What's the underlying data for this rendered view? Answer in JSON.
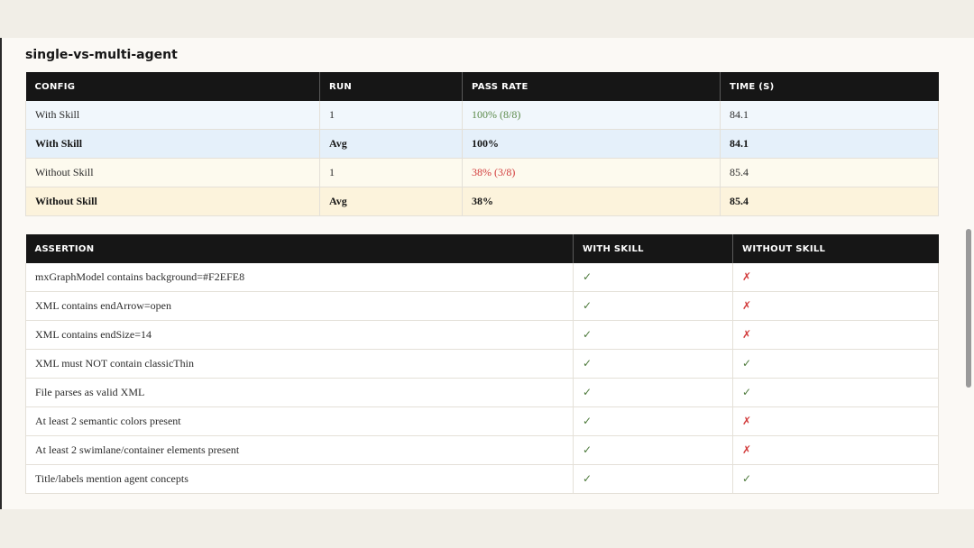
{
  "section": {
    "title": "single-vs-multi-agent"
  },
  "config_table": {
    "headers": [
      "CONFIG",
      "RUN",
      "PASS RATE",
      "TIME (S)"
    ],
    "rows": [
      {
        "config": "With Skill",
        "run": "1",
        "pass_rate": "100% (8/8)",
        "time": "84.1"
      },
      {
        "config": "With Skill",
        "run": "Avg",
        "pass_rate": "100%",
        "time": "84.1"
      },
      {
        "config": "Without Skill",
        "run": "1",
        "pass_rate": "38% (3/8)",
        "time": "85.4"
      },
      {
        "config": "Without Skill",
        "run": "Avg",
        "pass_rate": "38%",
        "time": "85.4"
      }
    ]
  },
  "assertion_table": {
    "headers": [
      "ASSERTION",
      "WITH SKILL",
      "WITHOUT SKILL"
    ],
    "pass_mark": "✓",
    "fail_mark": "✗",
    "rows": [
      {
        "assertion": "mxGraphModel contains background=#F2EFE8",
        "with": "✓",
        "without": "✗"
      },
      {
        "assertion": "XML contains endArrow=open",
        "with": "✓",
        "without": "✗"
      },
      {
        "assertion": "XML contains endSize=14",
        "with": "✓",
        "without": "✗"
      },
      {
        "assertion": "XML must NOT contain classicThin",
        "with": "✓",
        "without": "✓"
      },
      {
        "assertion": "File parses as valid XML",
        "with": "✓",
        "without": "✓"
      },
      {
        "assertion": "At least 2 semantic colors present",
        "with": "✓",
        "without": "✗"
      },
      {
        "assertion": "At least 2 swimlane/container elements present",
        "with": "✓",
        "without": "✗"
      },
      {
        "assertion": "Title/labels mention agent concepts",
        "with": "✓",
        "without": "✓"
      }
    ]
  },
  "colors": {
    "header_bg": "#161616",
    "pass_green": "#5b8a4a",
    "fail_red": "#d23b3b",
    "with_row_bg": "#f1f7fc",
    "without_row_bg": "#fdfaee"
  }
}
